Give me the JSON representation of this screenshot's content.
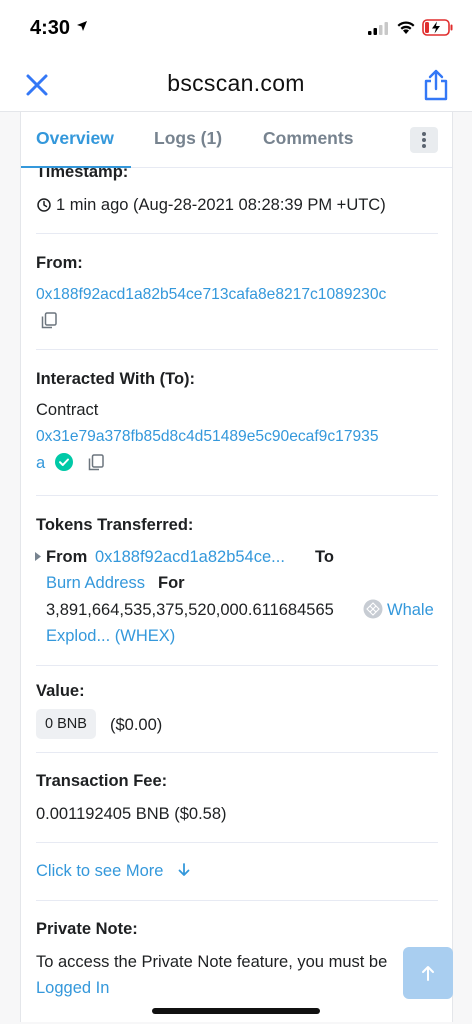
{
  "status_bar": {
    "time": "4:30"
  },
  "browser": {
    "site_title": "bscscan.com"
  },
  "tabs": [
    {
      "label": "Overview"
    },
    {
      "label": "Logs (1)"
    },
    {
      "label": "Comments"
    }
  ],
  "timestamp": {
    "label": "Timestamp:",
    "value": "1 min ago (Aug-28-2021 08:28:39 PM +UTC)"
  },
  "from": {
    "label": "From:",
    "address": "0x188f92acd1a82b54ce713cafa8e8217c1089230c"
  },
  "interacted_with": {
    "label": "Interacted With (To):",
    "type": "Contract",
    "address_line1": "0x31e79a378fb85d8c4d51489e5c90ecaf9c17935",
    "address_line2": "a"
  },
  "tokens_transferred": {
    "label": "Tokens Transferred:",
    "from_word": "From",
    "from_address": "0x188f92acd1a82b54ce...",
    "to_word": "To",
    "to_address": "Burn Address",
    "for_word": "For",
    "amount": "3,891,664,535,375,520,000.611684565",
    "token_line1": "Whale",
    "token_line2": "Explod... (WHEX)"
  },
  "value": {
    "label": "Value:",
    "amount": "0 BNB",
    "usd": "($0.00)"
  },
  "transaction_fee": {
    "label": "Transaction Fee:",
    "value": "0.001192405 BNB ($0.58)"
  },
  "see_more": {
    "label": "Click to see More"
  },
  "private_note": {
    "label": "Private Note:",
    "text": "To access the Private Note feature, you must be",
    "link": "Logged In"
  },
  "colors": {
    "link": "#3498db",
    "verified": "#00c9a7"
  }
}
